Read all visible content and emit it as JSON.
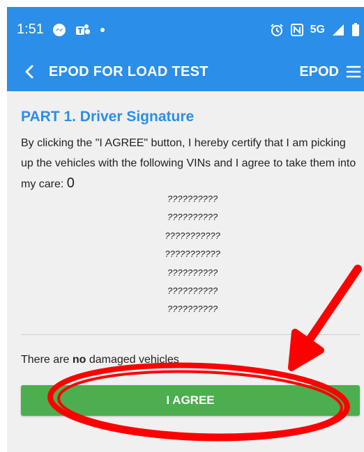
{
  "status_bar": {
    "time": "1:51",
    "network": "5G",
    "icons": [
      "messenger-icon",
      "teams-icon",
      "dot-icon",
      "alarm-icon",
      "nfc-icon",
      "signal-icon",
      "battery-icon"
    ]
  },
  "toolbar": {
    "title": "EPOD FOR LOAD TEST",
    "right_label": "EPOD",
    "icons": [
      "back-chevron-icon",
      "menu-icon"
    ]
  },
  "part": {
    "title": "PART 1.  Driver Signature",
    "intro_text": "By clicking the \"I AGREE\" button, I hereby certify that I am picking up the vehicles with the following VINs and I agree to take them into my care:",
    "vehicle_count": "0",
    "vins": [
      "??????????",
      "??????????",
      "???????????",
      "???????????",
      "??????????",
      "??????????",
      "??????????"
    ]
  },
  "damage": {
    "prefix": "There are",
    "emphasis": "no",
    "suffix": "damaged vehicles"
  },
  "agree_button": {
    "label": "I AGREE"
  },
  "colors": {
    "app_bar": "#2b8ee8",
    "title": "#2b8ee8",
    "agree_button": "#4cae4f",
    "annotation": "#ff0000",
    "background": "#f0f0f0"
  }
}
